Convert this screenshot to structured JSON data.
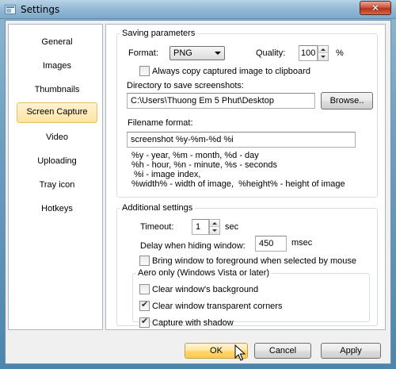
{
  "window": {
    "title": "Settings",
    "close_glyph": "✕"
  },
  "sidebar": {
    "items": [
      {
        "label": "General"
      },
      {
        "label": "Images"
      },
      {
        "label": "Thumbnails"
      },
      {
        "label": "Screen Capture"
      },
      {
        "label": "Video"
      },
      {
        "label": "Uploading"
      },
      {
        "label": "Tray icon"
      },
      {
        "label": "Hotkeys"
      }
    ],
    "active_index": 3
  },
  "saving": {
    "legend": "Saving parameters",
    "format_label": "Format:",
    "format_value": "PNG",
    "quality_label": "Quality:",
    "quality_value": "100",
    "quality_unit": "%",
    "copy_clipboard_label": "Always copy captured image to clipboard",
    "copy_clipboard_checked": false,
    "directory_label": "Directory to save screenshots:",
    "directory_value": "C:\\Users\\Thuong Em 5 Phut\\Desktop",
    "browse_label": "Browse..",
    "filename_label": "Filename format:",
    "filename_value": "screenshot %y-%m-%d %i",
    "help_lines": [
      "%y - year, %m - month, %d - day",
      "%h - hour, %n - minute, %s - seconds",
      " %i - image index,",
      "%width% - width of image,  %height% - height of image"
    ]
  },
  "additional": {
    "legend": "Additional settings",
    "timeout_label": "Timeout:",
    "timeout_value": "1",
    "timeout_unit": "sec",
    "delay_label": "Delay when hiding window:",
    "delay_value": "450",
    "delay_unit": "msec",
    "foreground_label": "Bring window to foreground when selected by mouse",
    "foreground_checked": false,
    "aero": {
      "legend": "Aero only (Windows Vista or later)",
      "clear_bg_label": "Clear window's background",
      "clear_bg_checked": false,
      "clear_corners_label": "Clear window transparent corners",
      "clear_corners_checked": true,
      "shadow_label": "Capture with shadow",
      "shadow_checked": true
    }
  },
  "footer": {
    "ok_label": "OK",
    "cancel_label": "Cancel",
    "apply_label": "Apply"
  }
}
